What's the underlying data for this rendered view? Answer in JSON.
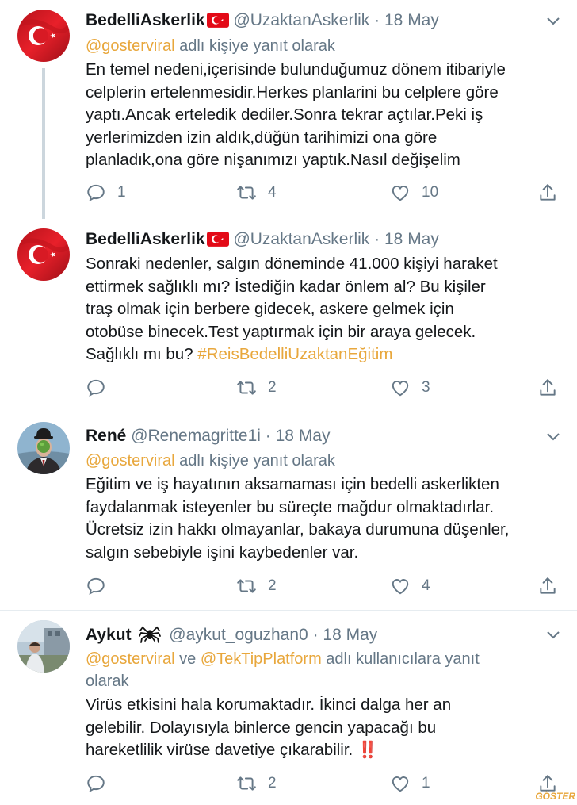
{
  "tweets": [
    {
      "name": "BedelliAskerlik",
      "handle": "@UzaktanAskerlik",
      "dot": "·",
      "date": "18 May",
      "reply_mention": "@gosterviral",
      "reply_suffix": " adlı kişiye yanıt olarak",
      "lines": [
        "En temel nedeni,içerisinde bulunduğumuz dönem itibariyle",
        "celplerin ertelenmesidir.Herkes planlarini bu celplere göre",
        "yaptı.Ancak erteledik dediler.Sonra tekrar açtılar.Peki iş",
        "yerlerimizden izin aldık,düğün tarihimizi ona göre",
        "planladık,ona göre nişanımızı yaptık.Nasıl değişelim"
      ],
      "reply_count": "1",
      "retweet_count": "4",
      "like_count": "10"
    },
    {
      "name": "BedelliAskerlik",
      "handle": "@UzaktanAskerlik",
      "dot": "·",
      "date": "18 May",
      "lines": [
        "Sonraki nedenler, salgın döneminde 41.000 kişiyi haraket",
        "ettirmek sağlıklı mı? İstediğin kadar önlem al? Bu kişiler",
        "traş olmak için berbere gidecek, askere gelmek için",
        "otobüse binecek.Test yaptırmak için bir araya gelecek."
      ],
      "last_line_text": "Sağlıklı mı bu? ",
      "hashtag": "#ReisBedelliUzaktanEğitim",
      "reply_count": "",
      "retweet_count": "2",
      "like_count": "3"
    },
    {
      "name": "René",
      "handle": "@Renemagritte1i",
      "dot": "·",
      "date": "18 May",
      "reply_mention": "@gosterviral",
      "reply_suffix": " adlı kişiye yanıt olarak",
      "lines": [
        "Eğitim ve iş hayatının aksamaması için bedelli askerlikten",
        "faydalanmak isteyenler bu süreçte mağdur olmaktadırlar.",
        "Ücretsiz izin hakkı olmayanlar, bakaya durumuna düşenler,",
        "salgın sebebiyle işini kaybedenler var."
      ],
      "reply_count": "",
      "retweet_count": "2",
      "like_count": "4"
    },
    {
      "name": "Aykut",
      "handle": "@aykut_oguzhan0",
      "dot": "·",
      "date": "18 May",
      "reply_mention": "@gosterviral",
      "reply_and": " ve ",
      "reply_mention2": "@TekTipPlatform",
      "reply_suffix": " adlı kullanıcılara yanıt",
      "reply_suffix2": "olarak",
      "lines": [
        "Virüs etkisini hala korumaktadır. İkinci dalga her an",
        "gelebilir. Dolayısıyla binlerce gencin yapacağı bu",
        "hareketlilik virüse davetiye çıkarabilir. ‼️"
      ],
      "reply_count": "",
      "retweet_count": "2",
      "like_count": "1"
    }
  ],
  "watermark": "GÖSTER",
  "icons": {
    "reply": "reply-icon",
    "retweet": "retweet-icon",
    "like": "heart-icon",
    "share": "share-icon",
    "caret": "chevron-down-icon",
    "flag": "turkey-flag-icon",
    "spider": "spider-icon"
  },
  "colors": {
    "mention": "#e8a73c",
    "secondary": "#657786",
    "flag_red": "#e30a17"
  }
}
